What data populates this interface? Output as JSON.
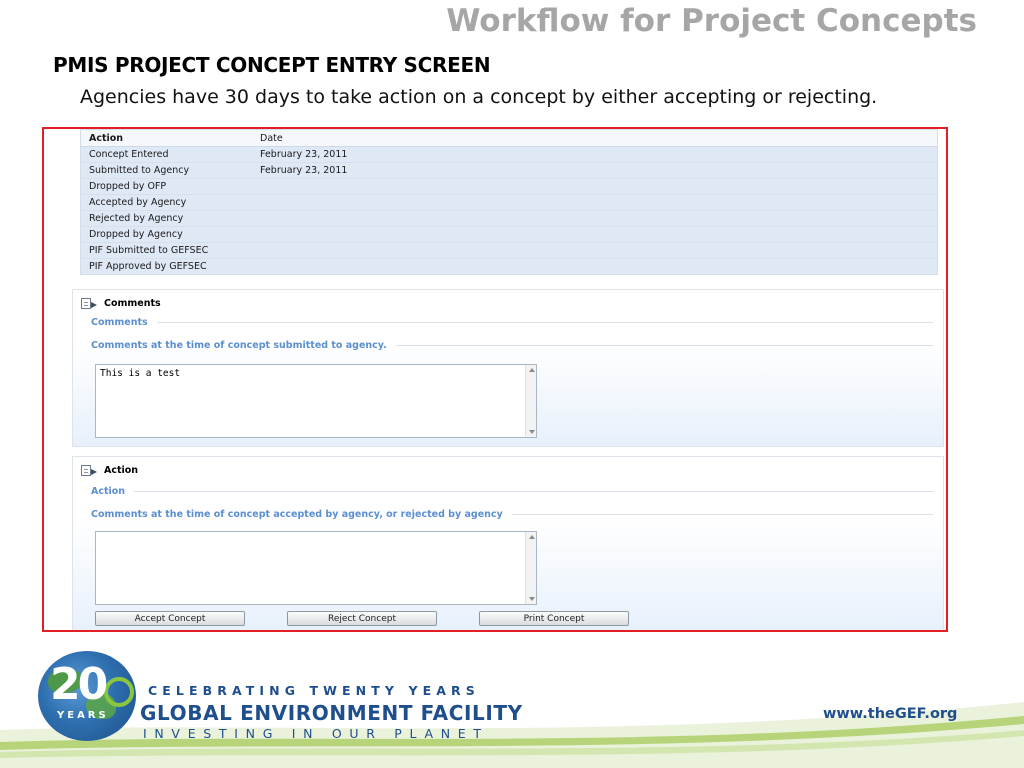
{
  "slide": {
    "title": "Workflow for Project Concepts",
    "heading": "PMIS PROJECT CONCEPT ENTRY SCREEN",
    "subheading": "Agencies have 30 days to take action on a concept by either accepting or rejecting."
  },
  "status_table": {
    "headers": {
      "action": "Action",
      "date": "Date"
    },
    "rows": [
      {
        "action": "Concept Entered",
        "date": "February 23, 2011"
      },
      {
        "action": "Submitted to Agency",
        "date": "February 23, 2011"
      },
      {
        "action": "Dropped by OFP",
        "date": ""
      },
      {
        "action": "Accepted by Agency",
        "date": ""
      },
      {
        "action": "Rejected by Agency",
        "date": ""
      },
      {
        "action": "Dropped by Agency",
        "date": ""
      },
      {
        "action": "PIF Submitted to GEFSEC",
        "date": ""
      },
      {
        "action": "PIF Approved by GEFSEC",
        "date": ""
      }
    ]
  },
  "comments_panel": {
    "title": "Comments",
    "section_label": "Comments",
    "field_label": "Comments at the time of concept submitted to agency.",
    "field_value": "This is a test"
  },
  "action_panel": {
    "title": "Action",
    "section_label": "Action",
    "field_label": "Comments at the time of concept accepted by agency, or rejected by agency",
    "field_value": "",
    "buttons": {
      "accept": "Accept Concept",
      "reject": "Reject Concept",
      "print": "Print Concept"
    }
  },
  "footer": {
    "logo_number": "20",
    "logo_years": "YEARS",
    "tagline_top": "CELEBRATING TWENTY YEARS",
    "org_name": "GLOBAL ENVIRONMENT FACILITY",
    "tagline_bottom": "INVESTING IN OUR PLANET",
    "url": "www.theGEF.org"
  },
  "colors": {
    "frame_border": "#e31e24",
    "brand_blue": "#1f4e8c",
    "brand_green": "#8cc63f",
    "section_label": "#5b8fd0"
  }
}
